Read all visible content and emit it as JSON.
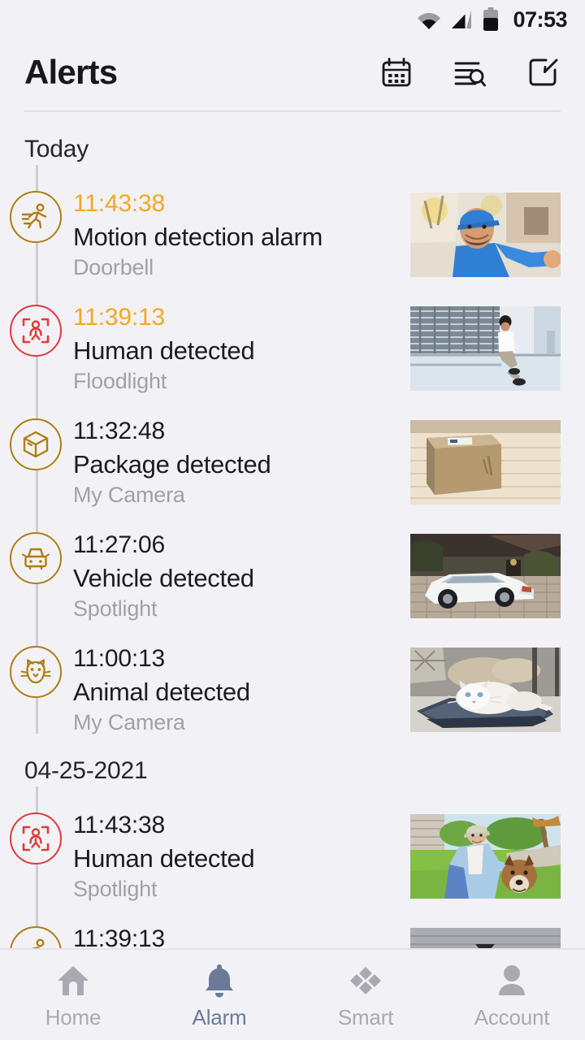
{
  "status_bar": {
    "time": "07:53",
    "icons": [
      "wifi-icon",
      "cellular-signal-icon",
      "battery-icon"
    ]
  },
  "header": {
    "title": "Alerts",
    "actions": [
      {
        "name": "calendar-icon",
        "label": "Calendar"
      },
      {
        "name": "filter-search-icon",
        "label": "Filter"
      },
      {
        "name": "edit-icon",
        "label": "Edit"
      }
    ]
  },
  "colors": {
    "background": "#f2f2f6",
    "alarm_time": "#f5a623",
    "badge_gold": "#b07d12",
    "badge_red": "#e03a3a",
    "text_primary": "#1b1c21",
    "text_muted": "#a0a1a8",
    "nav_active": "#6b7a96",
    "nav_inactive": "#a9aab1",
    "timeline_line": "#cdced4"
  },
  "sections": [
    {
      "label": "Today",
      "alerts": [
        {
          "time": "11:43:38",
          "title": "Motion detection alarm",
          "device": "Doorbell",
          "icon": "running-person-icon",
          "badge_color": "gold",
          "time_highlight": true,
          "thumbnail": "delivery-person-photo"
        },
        {
          "time": "11:39:13",
          "title": "Human detected",
          "device": "Floodlight",
          "icon": "human-detect-icon",
          "badge_color": "red",
          "time_highlight": true,
          "thumbnail": "person-by-railing-photo"
        },
        {
          "time": "11:32:48",
          "title": "Package detected",
          "device": "My Camera",
          "icon": "package-box-icon",
          "badge_color": "gold",
          "time_highlight": false,
          "thumbnail": "cardboard-box-photo"
        },
        {
          "time": "11:27:06",
          "title": "Vehicle detected",
          "device": "Spotlight",
          "icon": "car-icon",
          "badge_color": "gold",
          "time_highlight": false,
          "thumbnail": "white-car-driveway-photo"
        },
        {
          "time": "11:00:13",
          "title": "Animal detected",
          "device": "My Camera",
          "icon": "cat-face-icon",
          "badge_color": "gold",
          "time_highlight": false,
          "thumbnail": "white-cat-on-cushion-photo"
        }
      ]
    },
    {
      "label": "04-25-2021",
      "alerts": [
        {
          "time": "11:43:38",
          "title": "Human detected",
          "device": "Spotlight",
          "icon": "human-detect-icon",
          "badge_color": "red",
          "time_highlight": false,
          "thumbnail": "person-with-dog-photo"
        },
        {
          "time": "11:39:13",
          "title": "",
          "device": "",
          "icon": "running-person-icon",
          "badge_color": "gold",
          "time_highlight": false,
          "thumbnail": "partial-photo"
        }
      ]
    }
  ],
  "bottom_nav": {
    "items": [
      {
        "label": "Home",
        "icon": "home-icon",
        "active": false
      },
      {
        "label": "Alarm",
        "icon": "bell-icon",
        "active": true
      },
      {
        "label": "Smart",
        "icon": "diamonds-icon",
        "active": false
      },
      {
        "label": "Account",
        "icon": "person-icon",
        "active": false
      }
    ]
  }
}
